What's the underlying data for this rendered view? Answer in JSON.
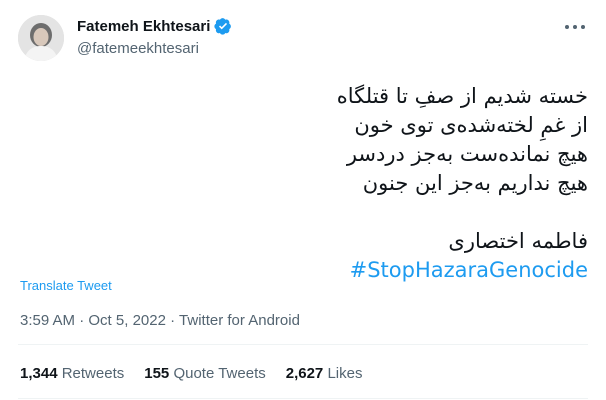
{
  "author": {
    "name": "Fatemeh Ekhtesari",
    "handle": "@fatemeekhtesari",
    "verified": true
  },
  "tweet": {
    "lines": [
      "خسته شدیم از صفِ تا قتلگاه",
      "از غمِ لخته‌شده‌ی توی خون",
      "هیچ نمانده‌ست به‌جز دردسر",
      "هیچ نداریم به‌جز این جنون"
    ],
    "signature": "فاطمه اختصاری",
    "hashtag": "#StopHazaraGenocide"
  },
  "translate_label": "Translate Tweet",
  "meta": {
    "time": "3:59 AM",
    "date": "Oct 5, 2022",
    "source": "Twitter for Android",
    "separator": "·"
  },
  "stats": {
    "retweets_count": "1,344",
    "retweets_label": "Retweets",
    "quotes_count": "155",
    "quotes_label": "Quote Tweets",
    "likes_count": "2,627",
    "likes_label": "Likes"
  },
  "colors": {
    "link": "#1d9bf0",
    "muted": "#536471",
    "text": "#0f1419"
  },
  "icons": {
    "verified": "verified-badge-icon",
    "more": "more-options-icon"
  }
}
